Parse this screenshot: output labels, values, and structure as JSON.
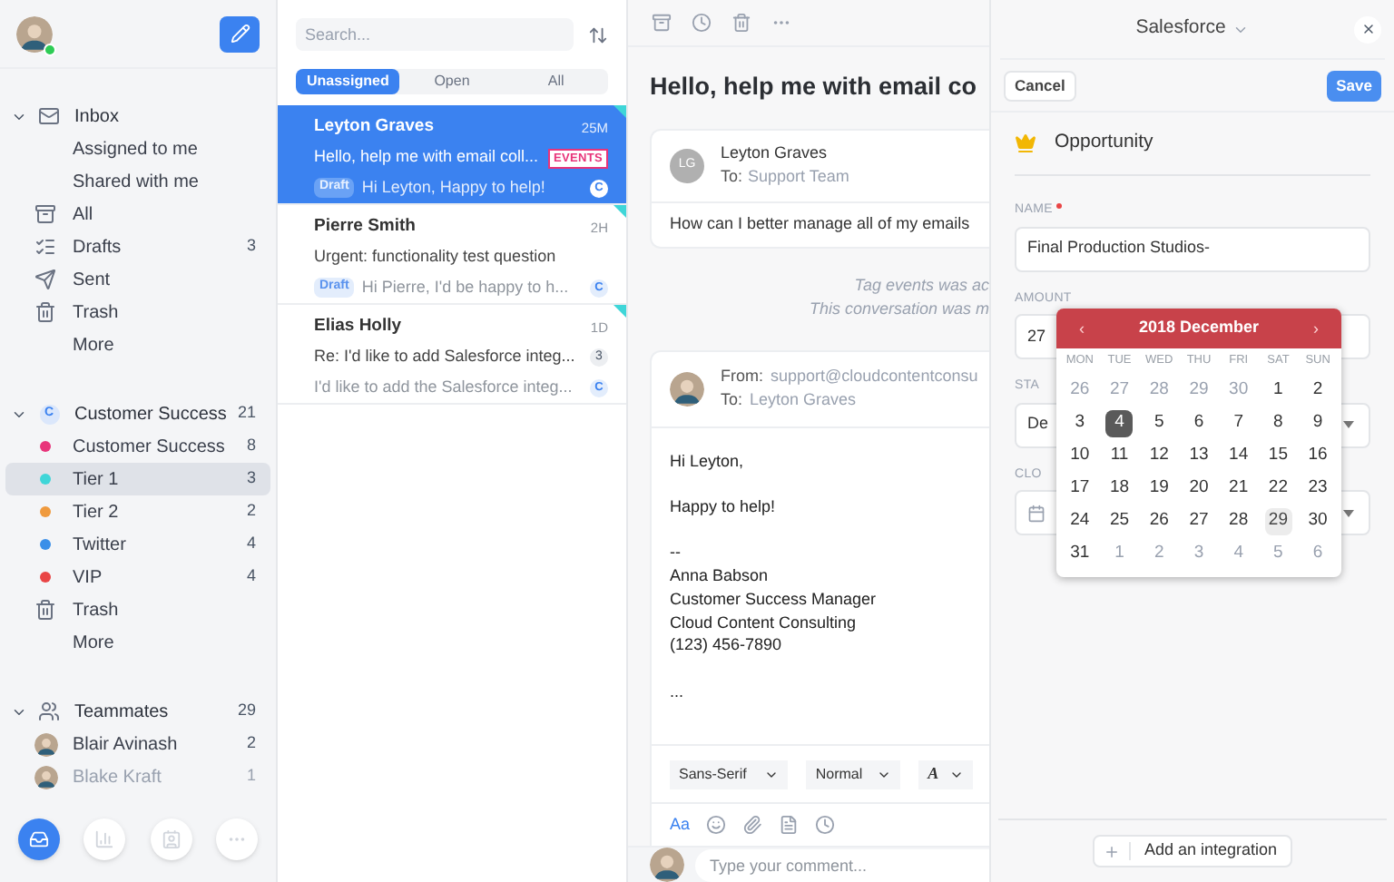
{
  "sidebar": {
    "online": true,
    "sections": [
      {
        "label": "Inbox",
        "kind": "inbox",
        "expanded": true,
        "items": [
          {
            "label": "Assigned to me",
            "kind": "plain",
            "selected": false
          },
          {
            "label": "Shared with me",
            "kind": "plain",
            "selected": false
          },
          {
            "label": "All",
            "kind": "all",
            "selected": false
          },
          {
            "label": "Drafts",
            "count": "3",
            "kind": "drafts",
            "selected": false
          },
          {
            "label": "Sent",
            "kind": "sent",
            "selected": false
          },
          {
            "label": "Trash",
            "kind": "trash",
            "selected": false
          },
          {
            "label": "More",
            "kind": "plain",
            "selected": false
          }
        ]
      },
      {
        "label": "Customer Success",
        "count": "21",
        "kind": "team",
        "badge": "C",
        "expanded": true,
        "items": [
          {
            "label": "Customer Success",
            "count": "8",
            "kind": "dot",
            "color": "#e8347a",
            "selected": false
          },
          {
            "label": "Tier 1",
            "count": "3",
            "kind": "dot",
            "color": "#3fd6d8",
            "selected": true
          },
          {
            "label": "Tier 2",
            "count": "2",
            "kind": "dot",
            "color": "#ef9a3e",
            "selected": false
          },
          {
            "label": "Twitter",
            "count": "4",
            "kind": "dot",
            "color": "#3b8fe8",
            "selected": false
          },
          {
            "label": "VIP",
            "count": "4",
            "kind": "dot",
            "color": "#e94545",
            "selected": false
          },
          {
            "label": "Trash",
            "kind": "trash",
            "selected": false
          },
          {
            "label": "More",
            "kind": "plain",
            "selected": false
          }
        ]
      },
      {
        "label": "Teammates",
        "count": "29",
        "kind": "people",
        "expanded": true,
        "items": [
          {
            "label": "Blair Avinash",
            "count": "2",
            "kind": "person",
            "selected": false,
            "faded": false
          },
          {
            "label": "Blake Kraft",
            "count": "1",
            "kind": "person",
            "selected": false,
            "faded": true
          }
        ]
      }
    ],
    "nav": [
      {
        "kind": "inbox",
        "selected": true
      },
      {
        "kind": "stats",
        "selected": false
      },
      {
        "kind": "contacts",
        "selected": false
      },
      {
        "kind": "more",
        "selected": false
      }
    ]
  },
  "list": {
    "search": {
      "placeholder": "Search..."
    },
    "tabs": [
      {
        "label": "Unassigned",
        "selected": true
      },
      {
        "label": "Open",
        "selected": false
      },
      {
        "label": "All",
        "selected": false
      }
    ],
    "items": [
      {
        "name": "Leyton Graves",
        "time": "25M",
        "subject": "Hello, help me with email coll...",
        "tag": "EVENTS",
        "draft": "Draft",
        "preview": "Hi Leyton, Happy to help!",
        "inbox": "C",
        "selected": true
      },
      {
        "name": "Pierre Smith",
        "time": "2H",
        "subject": "Urgent: functionality test question",
        "draft": "Draft",
        "preview": "Hi Pierre, I'd be happy to h...",
        "inbox": "C",
        "selected": false
      },
      {
        "name": "Elias Holly",
        "time": "1D",
        "subject": "Re: I'd like to add Salesforce integ...",
        "count": "3",
        "preview": "I'd like to add the Salesforce integ...",
        "inbox": "C",
        "selected": false
      }
    ]
  },
  "conversation": {
    "title": "Hello, help me with email co",
    "message": {
      "initials": "LG",
      "from": "Leyton Graves",
      "to_label": "To:",
      "to": "Support Team",
      "body": "How can I better manage all of my emails"
    },
    "events": [
      "Tag events was ac",
      "This conversation was m"
    ],
    "reply": {
      "from_label": "From:",
      "from": "support@cloudcontentconsu",
      "to_label": "To:",
      "to": "Leyton Graves",
      "paragraphs": [
        [
          "Hi Leyton,"
        ],
        [
          "Happy to help!"
        ],
        [
          "--",
          "Anna Babson",
          "Customer Success Manager",
          "Cloud Content Consulting",
          "(123) 456-7890"
        ],
        [
          "..."
        ]
      ],
      "font": "Sans-Serif",
      "size": "Normal",
      "style": "A",
      "aa": "Aa"
    },
    "comment": {
      "placeholder": "Type your comment..."
    }
  },
  "panel": {
    "title": "Salesforce",
    "cancel": "Cancel",
    "save": "Save",
    "section": "Opportunity",
    "fields": [
      {
        "label": "NAME",
        "required": true,
        "value": "Final Production Studios-",
        "kind": "text"
      },
      {
        "label": "AMOUNT",
        "value": "27",
        "kind": "text"
      },
      {
        "label": "STA",
        "value": "De",
        "kind": "select"
      },
      {
        "label": "CLO",
        "kind": "date"
      }
    ],
    "calendar": {
      "prev": "‹",
      "title": "2018 December",
      "next": "›",
      "weekdays": [
        "MON",
        "TUE",
        "WED",
        "THU",
        "FRI",
        "SAT",
        "SUN"
      ],
      "weeks": [
        [
          {
            "d": "26",
            "muted": true
          },
          {
            "d": "27",
            "muted": true
          },
          {
            "d": "28",
            "muted": true
          },
          {
            "d": "29",
            "muted": true
          },
          {
            "d": "30",
            "muted": true
          },
          {
            "d": "1"
          },
          {
            "d": "2"
          }
        ],
        [
          {
            "d": "3"
          },
          {
            "d": "4",
            "selected": true
          },
          {
            "d": "5"
          },
          {
            "d": "6"
          },
          {
            "d": "7"
          },
          {
            "d": "8"
          },
          {
            "d": "9"
          }
        ],
        [
          {
            "d": "10"
          },
          {
            "d": "11"
          },
          {
            "d": "12"
          },
          {
            "d": "13"
          },
          {
            "d": "14"
          },
          {
            "d": "15"
          },
          {
            "d": "16"
          }
        ],
        [
          {
            "d": "17"
          },
          {
            "d": "18"
          },
          {
            "d": "19"
          },
          {
            "d": "20"
          },
          {
            "d": "21"
          },
          {
            "d": "22"
          },
          {
            "d": "23"
          }
        ],
        [
          {
            "d": "24"
          },
          {
            "d": "25"
          },
          {
            "d": "26"
          },
          {
            "d": "27"
          },
          {
            "d": "28"
          },
          {
            "d": "29",
            "today": true
          },
          {
            "d": "30"
          }
        ],
        [
          {
            "d": "31"
          },
          {
            "d": "1",
            "muted": true
          },
          {
            "d": "2",
            "muted": true
          },
          {
            "d": "3",
            "muted": true
          },
          {
            "d": "4",
            "muted": true
          },
          {
            "d": "5",
            "muted": true
          },
          {
            "d": "6",
            "muted": true
          }
        ]
      ]
    },
    "add": "Add an integration"
  }
}
